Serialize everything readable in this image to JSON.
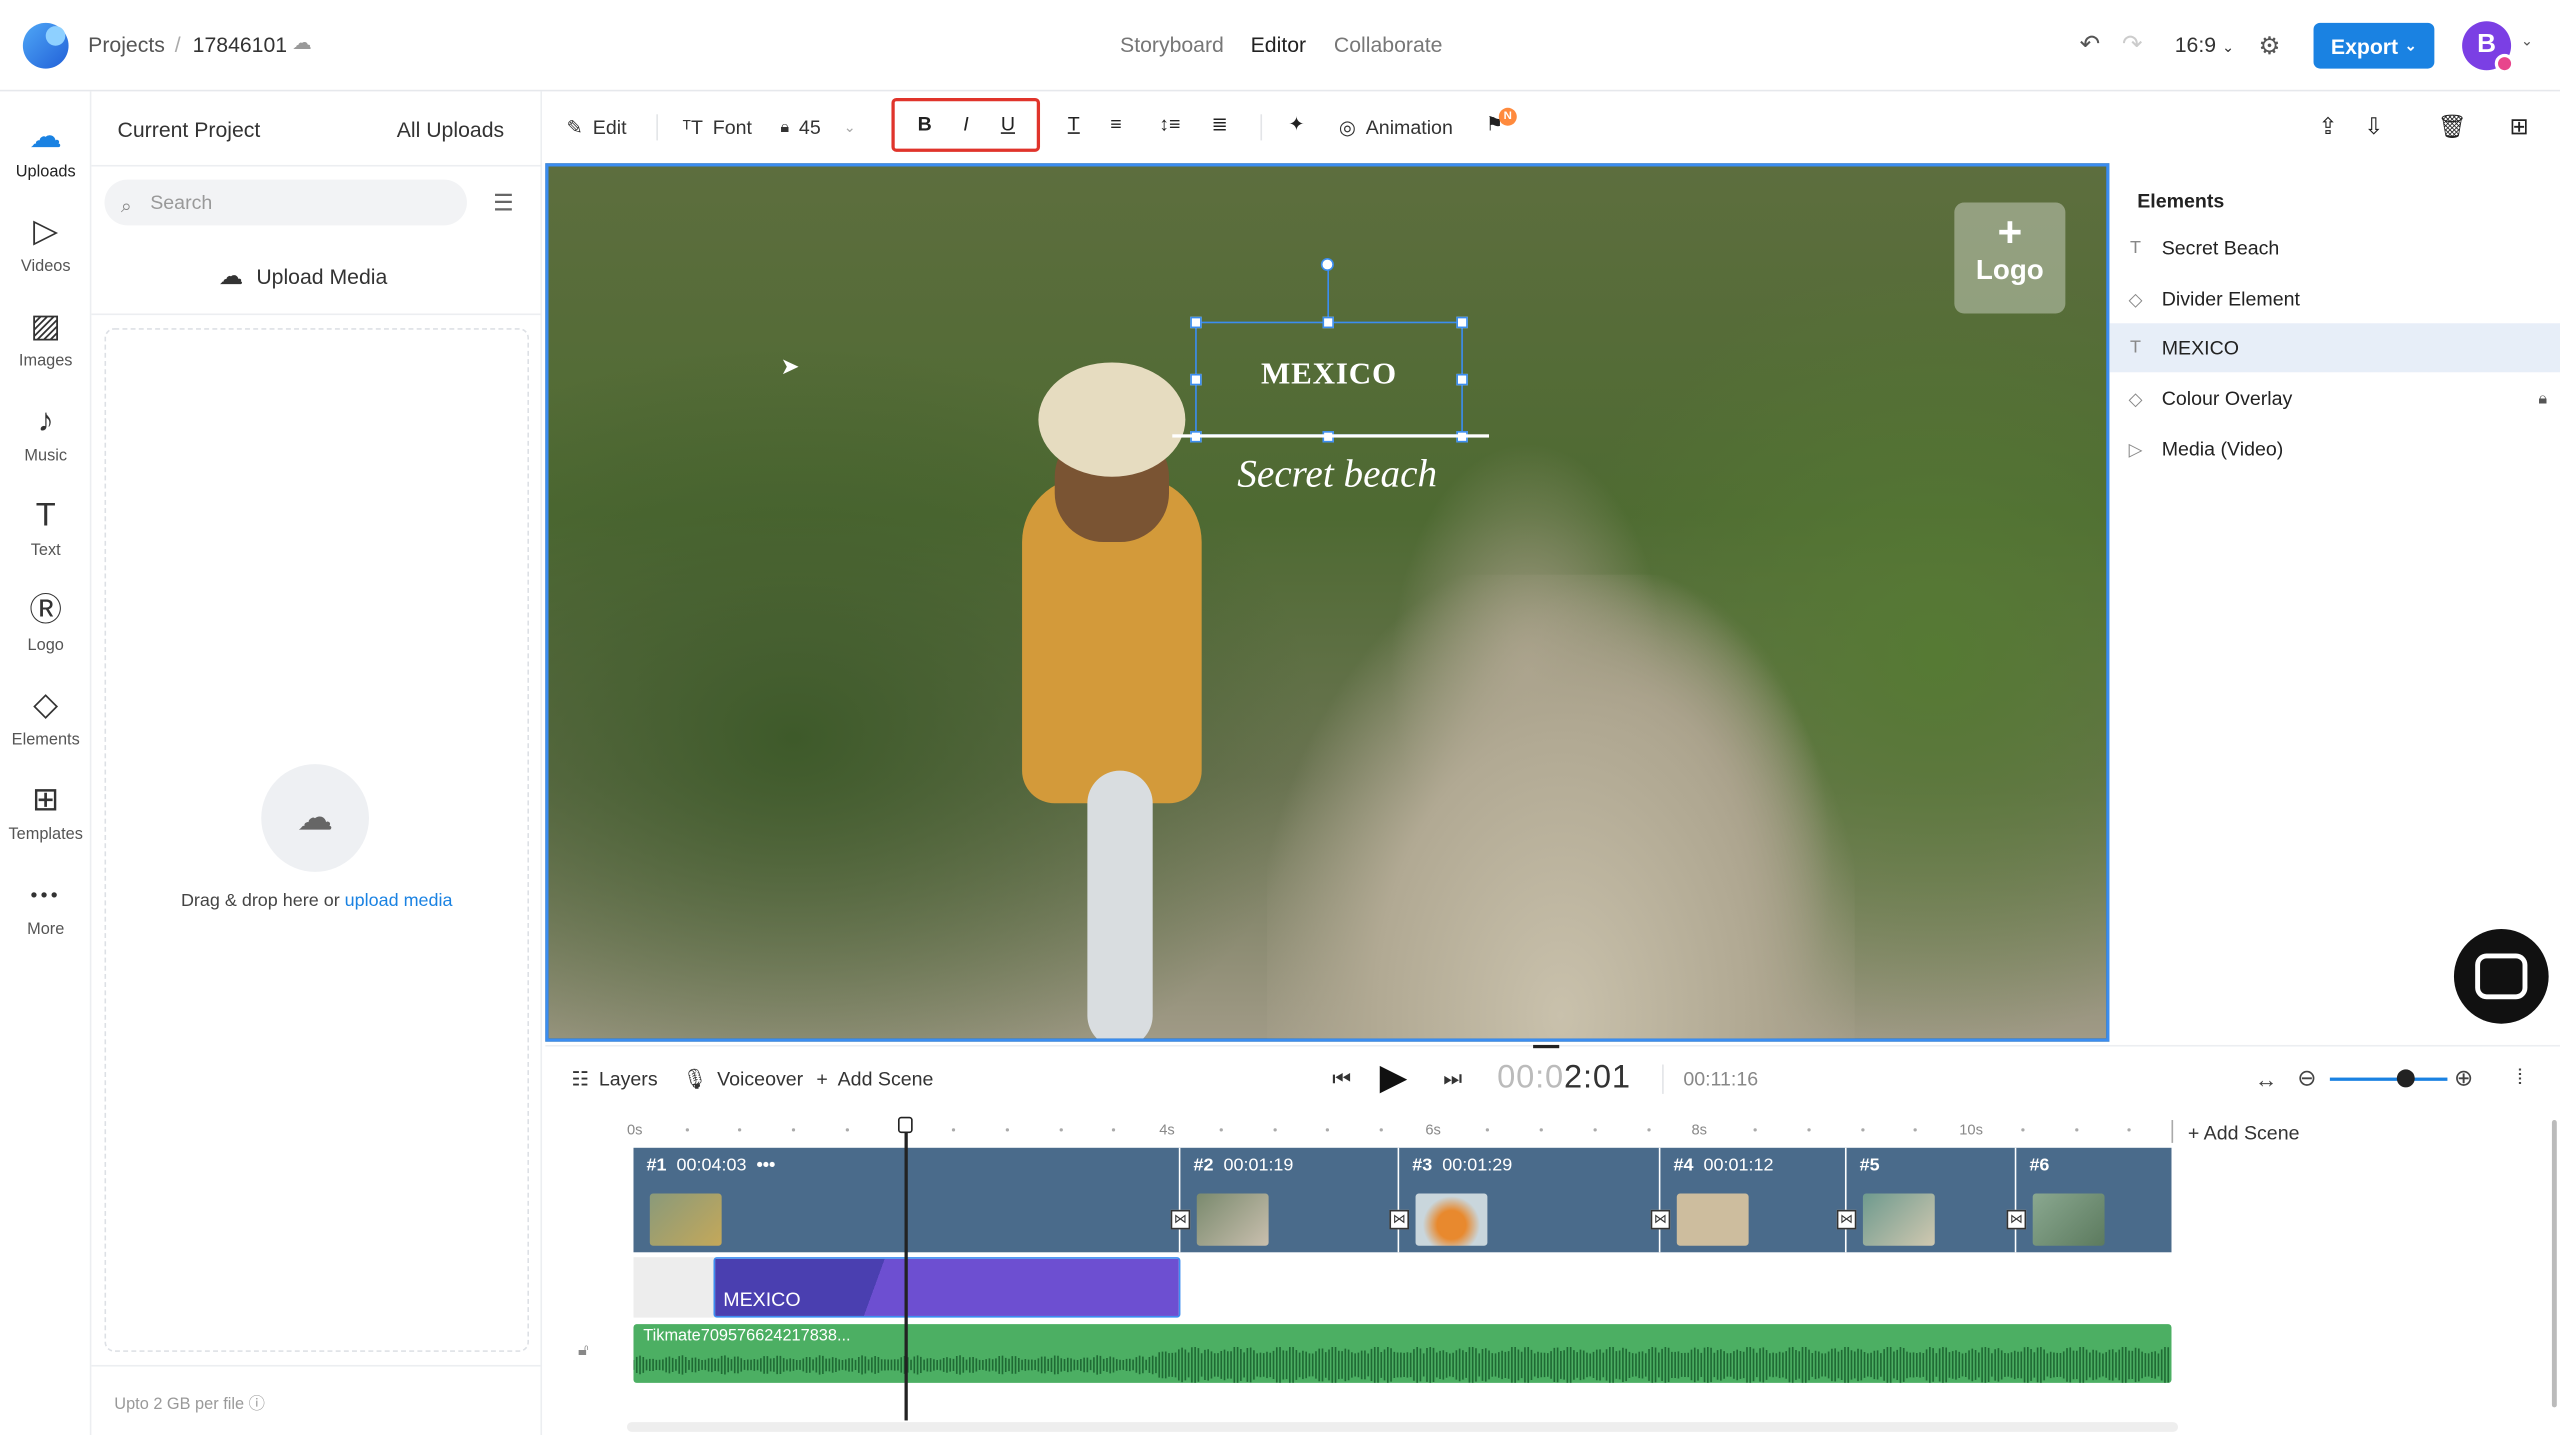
{
  "topbar": {
    "breadcrumb_root": "Projects",
    "breadcrumb_sep": "/",
    "project_id": "17846101",
    "tabs": [
      "Storyboard",
      "Editor",
      "Collaborate"
    ],
    "active_tab": "Editor",
    "aspect_ratio": "16:9",
    "export_label": "Export",
    "avatar_initial": "B"
  },
  "rail": [
    {
      "label": "Uploads",
      "icon": "upload-cloud-icon",
      "glyph": "☁",
      "active": true
    },
    {
      "label": "Videos",
      "icon": "video-icon",
      "glyph": "▷"
    },
    {
      "label": "Images",
      "icon": "image-icon",
      "glyph": "▨"
    },
    {
      "label": "Music",
      "icon": "music-icon",
      "glyph": "♪"
    },
    {
      "label": "Text",
      "icon": "text-icon",
      "glyph": "T"
    },
    {
      "label": "Logo",
      "icon": "logo-icon",
      "glyph": "Ⓡ"
    },
    {
      "label": "Elements",
      "icon": "elements-icon",
      "glyph": "◇"
    },
    {
      "label": "Templates",
      "icon": "templates-icon",
      "glyph": "⊞"
    },
    {
      "label": "More",
      "icon": "more-icon",
      "glyph": "•••"
    }
  ],
  "panel": {
    "tab_current": "Current Project",
    "tab_all": "All Uploads",
    "search_placeholder": "Search",
    "upload_button": "Upload Media",
    "drop_text": "Drag & drop here or",
    "drop_link": "upload media",
    "limit_text": "Upto 2 GB per file"
  },
  "toolbar": {
    "edit": "Edit",
    "font": "Font",
    "font_size": "45",
    "bold": "B",
    "italic": "I",
    "underline": "U",
    "animation": "Animation",
    "notif_badge": "N"
  },
  "canvas": {
    "logo_placeholder": "Logo",
    "heading_text": "MEXICO",
    "subheading_text": "Secret beach"
  },
  "elements": {
    "title": "Elements",
    "items": [
      {
        "label": "Secret Beach",
        "type": "text",
        "glyph": "T"
      },
      {
        "label": "Divider Element",
        "type": "shape",
        "glyph": "◇"
      },
      {
        "label": "MEXICO",
        "type": "text",
        "glyph": "T",
        "selected": true
      },
      {
        "label": "Colour Overlay",
        "type": "shape",
        "glyph": "◇",
        "locked": true
      },
      {
        "label": "Media (Video)",
        "type": "media",
        "glyph": "▷"
      }
    ]
  },
  "timeline": {
    "layers": "Layers",
    "voiceover": "Voiceover",
    "add_scene": "Add Scene",
    "current_time_dim": "00:0",
    "current_time": "2:01",
    "total_time": "00:11:16",
    "add_scene_right": "Add Scene",
    "ticks": [
      "0s",
      "4s",
      "6s",
      "8s",
      "10s"
    ],
    "scenes": [
      {
        "label": "#1",
        "duration": "00:04:03",
        "thumb": "#8a9a7a"
      },
      {
        "label": "#2",
        "duration": "00:01:19",
        "thumb": "#7a8a6e"
      },
      {
        "label": "#3",
        "duration": "00:01:29",
        "thumb": "#d9893a"
      },
      {
        "label": "#4",
        "duration": "00:01:12",
        "thumb": "#cdbd9e"
      },
      {
        "label": "#5",
        "duration": "",
        "thumb": "#6e9a8e"
      },
      {
        "label": "#6",
        "duration": "",
        "thumb": "#8aa890"
      }
    ],
    "text_track_label": "MEXICO",
    "audio_label": "Tikmate709576624217838..."
  }
}
